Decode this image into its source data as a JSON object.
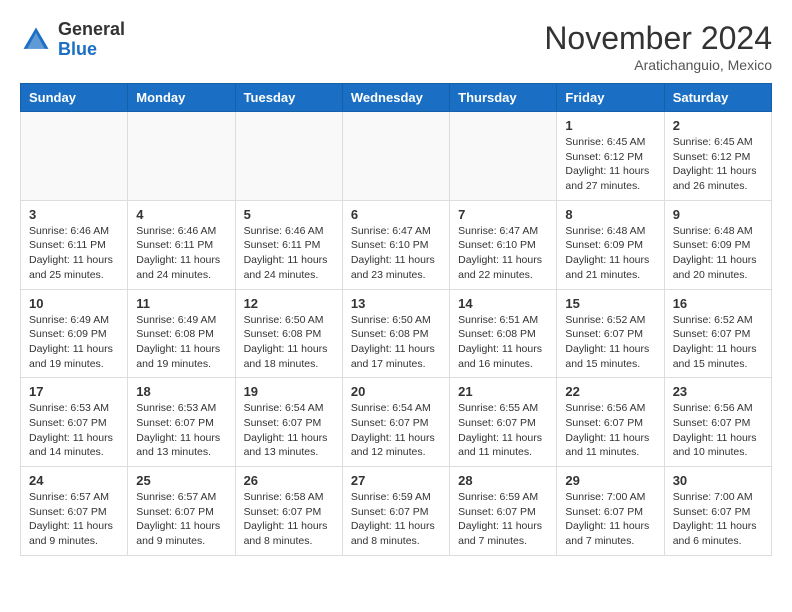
{
  "header": {
    "logo_line1": "General",
    "logo_line2": "Blue",
    "month": "November 2024",
    "location": "Aratichanguio, Mexico"
  },
  "weekdays": [
    "Sunday",
    "Monday",
    "Tuesday",
    "Wednesday",
    "Thursday",
    "Friday",
    "Saturday"
  ],
  "weeks": [
    [
      {
        "day": "",
        "info": ""
      },
      {
        "day": "",
        "info": ""
      },
      {
        "day": "",
        "info": ""
      },
      {
        "day": "",
        "info": ""
      },
      {
        "day": "",
        "info": ""
      },
      {
        "day": "1",
        "info": "Sunrise: 6:45 AM\nSunset: 6:12 PM\nDaylight: 11 hours\nand 27 minutes."
      },
      {
        "day": "2",
        "info": "Sunrise: 6:45 AM\nSunset: 6:12 PM\nDaylight: 11 hours\nand 26 minutes."
      }
    ],
    [
      {
        "day": "3",
        "info": "Sunrise: 6:46 AM\nSunset: 6:11 PM\nDaylight: 11 hours\nand 25 minutes."
      },
      {
        "day": "4",
        "info": "Sunrise: 6:46 AM\nSunset: 6:11 PM\nDaylight: 11 hours\nand 24 minutes."
      },
      {
        "day": "5",
        "info": "Sunrise: 6:46 AM\nSunset: 6:11 PM\nDaylight: 11 hours\nand 24 minutes."
      },
      {
        "day": "6",
        "info": "Sunrise: 6:47 AM\nSunset: 6:10 PM\nDaylight: 11 hours\nand 23 minutes."
      },
      {
        "day": "7",
        "info": "Sunrise: 6:47 AM\nSunset: 6:10 PM\nDaylight: 11 hours\nand 22 minutes."
      },
      {
        "day": "8",
        "info": "Sunrise: 6:48 AM\nSunset: 6:09 PM\nDaylight: 11 hours\nand 21 minutes."
      },
      {
        "day": "9",
        "info": "Sunrise: 6:48 AM\nSunset: 6:09 PM\nDaylight: 11 hours\nand 20 minutes."
      }
    ],
    [
      {
        "day": "10",
        "info": "Sunrise: 6:49 AM\nSunset: 6:09 PM\nDaylight: 11 hours\nand 19 minutes."
      },
      {
        "day": "11",
        "info": "Sunrise: 6:49 AM\nSunset: 6:08 PM\nDaylight: 11 hours\nand 19 minutes."
      },
      {
        "day": "12",
        "info": "Sunrise: 6:50 AM\nSunset: 6:08 PM\nDaylight: 11 hours\nand 18 minutes."
      },
      {
        "day": "13",
        "info": "Sunrise: 6:50 AM\nSunset: 6:08 PM\nDaylight: 11 hours\nand 17 minutes."
      },
      {
        "day": "14",
        "info": "Sunrise: 6:51 AM\nSunset: 6:08 PM\nDaylight: 11 hours\nand 16 minutes."
      },
      {
        "day": "15",
        "info": "Sunrise: 6:52 AM\nSunset: 6:07 PM\nDaylight: 11 hours\nand 15 minutes."
      },
      {
        "day": "16",
        "info": "Sunrise: 6:52 AM\nSunset: 6:07 PM\nDaylight: 11 hours\nand 15 minutes."
      }
    ],
    [
      {
        "day": "17",
        "info": "Sunrise: 6:53 AM\nSunset: 6:07 PM\nDaylight: 11 hours\nand 14 minutes."
      },
      {
        "day": "18",
        "info": "Sunrise: 6:53 AM\nSunset: 6:07 PM\nDaylight: 11 hours\nand 13 minutes."
      },
      {
        "day": "19",
        "info": "Sunrise: 6:54 AM\nSunset: 6:07 PM\nDaylight: 11 hours\nand 13 minutes."
      },
      {
        "day": "20",
        "info": "Sunrise: 6:54 AM\nSunset: 6:07 PM\nDaylight: 11 hours\nand 12 minutes."
      },
      {
        "day": "21",
        "info": "Sunrise: 6:55 AM\nSunset: 6:07 PM\nDaylight: 11 hours\nand 11 minutes."
      },
      {
        "day": "22",
        "info": "Sunrise: 6:56 AM\nSunset: 6:07 PM\nDaylight: 11 hours\nand 11 minutes."
      },
      {
        "day": "23",
        "info": "Sunrise: 6:56 AM\nSunset: 6:07 PM\nDaylight: 11 hours\nand 10 minutes."
      }
    ],
    [
      {
        "day": "24",
        "info": "Sunrise: 6:57 AM\nSunset: 6:07 PM\nDaylight: 11 hours\nand 9 minutes."
      },
      {
        "day": "25",
        "info": "Sunrise: 6:57 AM\nSunset: 6:07 PM\nDaylight: 11 hours\nand 9 minutes."
      },
      {
        "day": "26",
        "info": "Sunrise: 6:58 AM\nSunset: 6:07 PM\nDaylight: 11 hours\nand 8 minutes."
      },
      {
        "day": "27",
        "info": "Sunrise: 6:59 AM\nSunset: 6:07 PM\nDaylight: 11 hours\nand 8 minutes."
      },
      {
        "day": "28",
        "info": "Sunrise: 6:59 AM\nSunset: 6:07 PM\nDaylight: 11 hours\nand 7 minutes."
      },
      {
        "day": "29",
        "info": "Sunrise: 7:00 AM\nSunset: 6:07 PM\nDaylight: 11 hours\nand 7 minutes."
      },
      {
        "day": "30",
        "info": "Sunrise: 7:00 AM\nSunset: 6:07 PM\nDaylight: 11 hours\nand 6 minutes."
      }
    ]
  ]
}
